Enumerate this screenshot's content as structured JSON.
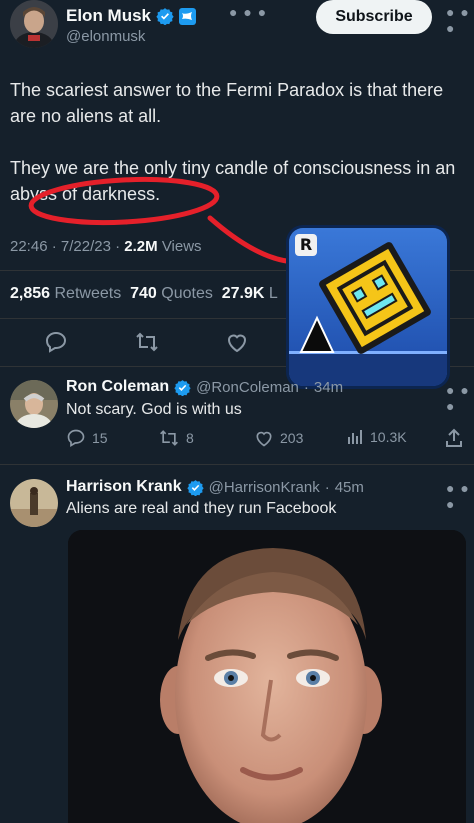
{
  "main_tweet": {
    "author_name": "Elon Musk",
    "handle": "@elonmusk",
    "subscribe_label": "Subscribe",
    "text_p1": "The scariest answer to the Fermi Paradox is that there are no aliens at all.",
    "text_p2": "They we are the only tiny candle of consciousness in an abyss of darkness.",
    "time": "22:46",
    "date": "7/22/23",
    "views_count": "2.2M",
    "views_label": "Views",
    "retweets_count": "2,856",
    "retweets_label": "Retweets",
    "quotes_count": "740",
    "quotes_label": "Quotes",
    "likes_count": "27.9K",
    "likes_label_partial": "L"
  },
  "overlay": {
    "badge_letter": "R",
    "annotation_color": "#e5202a"
  },
  "reply1": {
    "author_name": "Ron Coleman",
    "handle": "@RonColeman",
    "time": "34m",
    "text": "Not scary. God is with us",
    "replies": "15",
    "retweets": "8",
    "likes": "203",
    "views": "10.3K"
  },
  "reply2": {
    "author_name": "Harrison Krank",
    "handle": "@HarrisonKrank",
    "time": "45m",
    "text": "Aliens are real and they run Facebook"
  },
  "colors": {
    "background": "#15202b",
    "verified_blue": "#1d9bf0",
    "muted": "#8b98a5"
  }
}
